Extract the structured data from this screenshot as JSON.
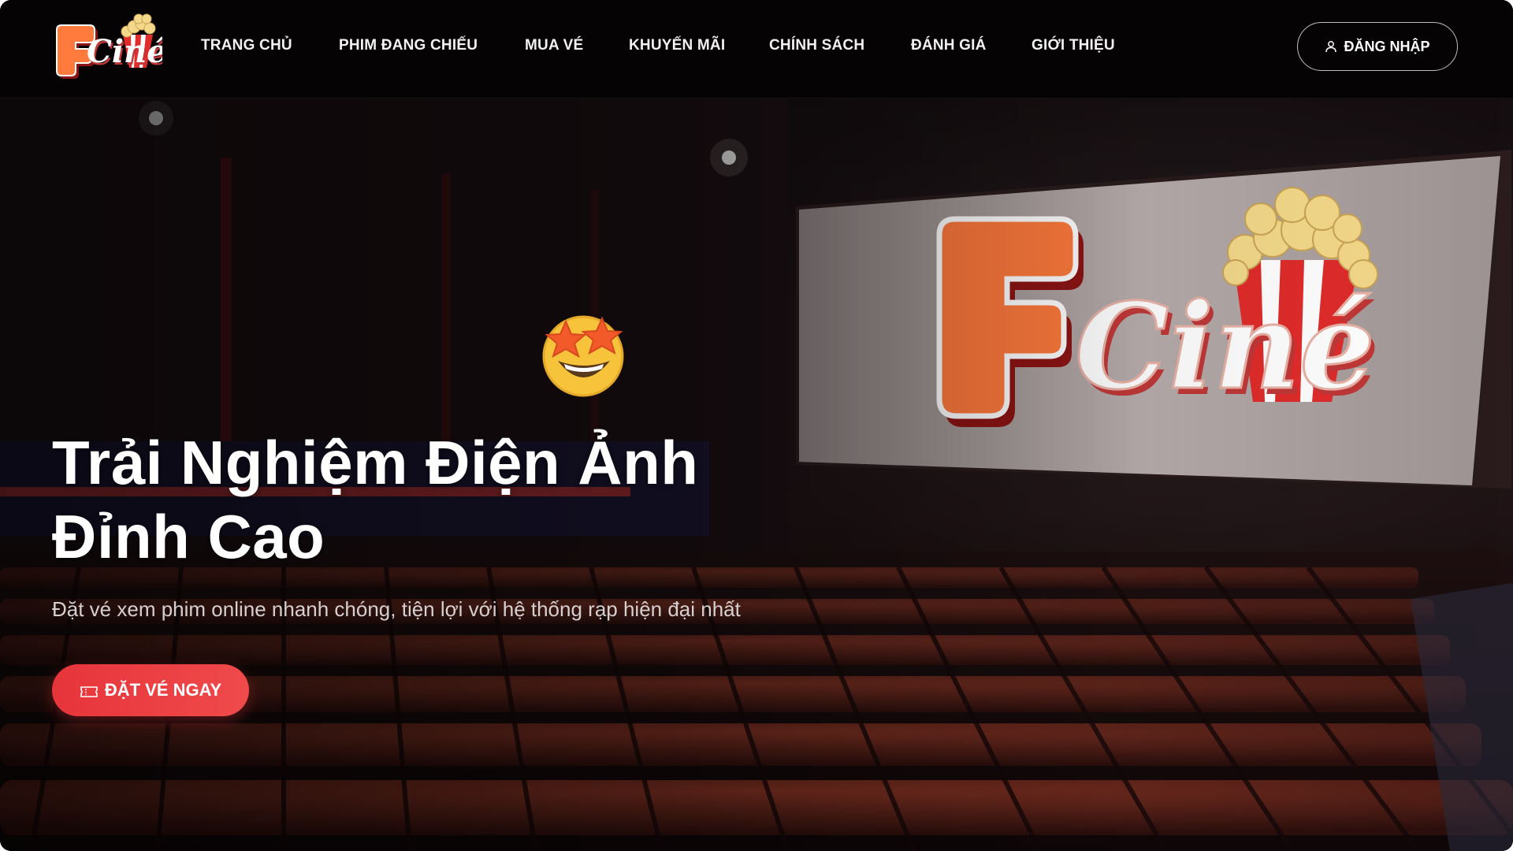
{
  "brand": {
    "logo_text": "FCiné",
    "colors": {
      "accent": "#E6353B",
      "logo_orange": "#FF7A3D",
      "logo_red": "#C42A2A",
      "background": "#050304"
    }
  },
  "nav": {
    "items": [
      {
        "label": "TRANG CHỦ"
      },
      {
        "label": "PHIM ĐANG CHIẾU"
      },
      {
        "label": "MUA VÉ"
      },
      {
        "label": "KHUYẾN MÃI"
      },
      {
        "label": "CHÍNH SÁCH"
      },
      {
        "label": "ĐÁNH GIÁ"
      },
      {
        "label": "GIỚI THIỆU"
      }
    ],
    "login_label": "ĐĂNG NHẬP",
    "login_icon": "user-icon"
  },
  "hero": {
    "emoji": "star-struck-emoji",
    "title_line1": "Trải Nghiệm Điện Ảnh",
    "title_line2": "Đỉnh Cao",
    "subtitle": "Đặt vé xem phim online nhanh chóng, tiện lợi với hệ thống rạp hiện đại nhất",
    "cta_label": "ĐẶT VÉ NGAY",
    "cta_icon": "ticket-icon",
    "background": "cinema-hall-image"
  }
}
